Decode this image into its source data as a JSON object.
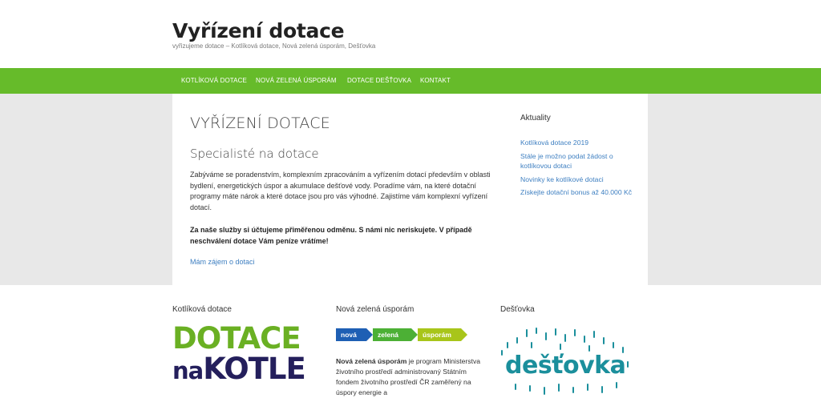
{
  "site": {
    "title": "Vyřízení dotace",
    "description": "vyřizujeme dotace – Kotlíková dotace, Nová zelená úsporám, Dešťovka"
  },
  "nav": {
    "items": [
      {
        "label": "KOTLÍKOVÁ DOTACE"
      },
      {
        "label": "NOVÁ ZELENÁ ÚSPORÁM"
      },
      {
        "label": "DOTACE DEŠŤOVKA"
      },
      {
        "label": "KONTAKT"
      }
    ]
  },
  "main": {
    "page_title": "VYŘÍZENÍ DOTACE",
    "subtitle": "Specialisté na dotace",
    "paragraph1": "Zabýváme se poradenstvím, komplexním zpracováním a vyřízením dotací především v oblasti bydlení, energetických úspor a akumulace dešťové vody. Poradíme vám, na které dotační programy máte nárok a které dotace jsou pro vás výhodné. Zajistíme vám komplexní vyřízení dotací.",
    "paragraph2": "Za naše služby si účtujeme přiměřenou odměnu. S námi nic neriskujete. V případě neschválení dotace Vám peníze vrátíme!",
    "cta_link": "Mám zájem o dotaci"
  },
  "sidebar": {
    "title": "Aktuality",
    "news": [
      {
        "label": "Kotlíková dotace 2019"
      },
      {
        "label": "Stále je možno podat žádost o kotlíkovou dotaci"
      },
      {
        "label": "Novinky ke kotlíkové dotaci"
      },
      {
        "label": "Získejte dotační bonus až 40.000 Kč"
      }
    ]
  },
  "footer_widgets": {
    "kotlikova": {
      "title": "Kotlíková dotace",
      "logo_line1": "DOTACE",
      "logo_line2_small": "na",
      "logo_line2": "KOTLE"
    },
    "nzu": {
      "title": "Nová zelená úsporám",
      "logo_words": [
        "nová",
        "zelená",
        "úsporám"
      ],
      "text_bold": "Nová zelená úsporám",
      "text_rest": " je program Ministerstva životního prostředí administrovaný Státním fondem životního prostředí ČR zaměřený na úspory energie a"
    },
    "destovka": {
      "title": "Dešťovka",
      "logo_word": "dešťovka"
    }
  },
  "colors": {
    "nav_green": "#66bb2a",
    "link_blue": "#3e7fc1",
    "nzu_blue": "#1e5fb4",
    "nzu_green": "#4cb035",
    "nzu_lime": "#a8c51a",
    "destovka_teal": "#1b8f9c"
  }
}
